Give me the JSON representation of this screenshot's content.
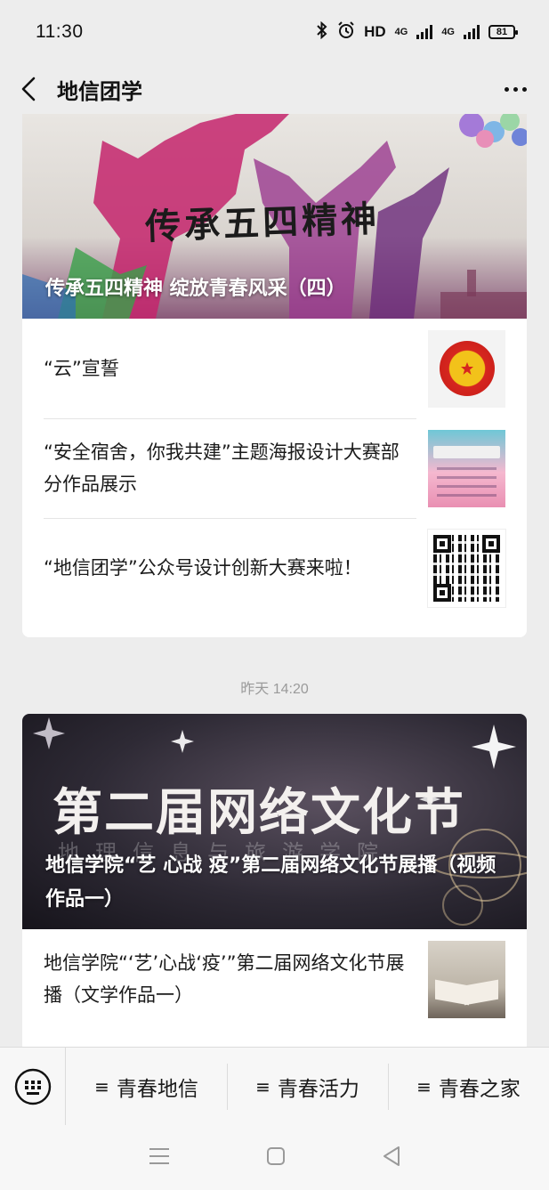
{
  "status_bar": {
    "time": "11:30",
    "hd_label": "HD",
    "net1": "4G",
    "net2": "4G",
    "battery": "81"
  },
  "nav": {
    "title": "地信团学"
  },
  "article_group_1": {
    "hero_art_text": "传承五四精神",
    "hero_caption": "传承五四精神 绽放青春风采（四）",
    "items": [
      {
        "title": "“云”宣誓",
        "thumb_icon": "league-emblem-icon"
      },
      {
        "title": "“安全宿舍，你我共建”主题海报设计大赛部分作品展示",
        "thumb_icon": "poster-thumbnail"
      },
      {
        "title": "“地信团学”公众号设计创新大赛来啦！",
        "thumb_icon": "qr-code-thumbnail"
      }
    ]
  },
  "timestamp": "昨天 14:20",
  "article_group_2": {
    "hero_art_text": "第二届网络文化节",
    "hero_art_sub": "地理信息与旅游学院",
    "hero_caption": "地信学院“艺 心战 疫”第二届网络文化节展播（视频作品一）",
    "items": [
      {
        "title": "地信学院“‘艺’心战‘疫’”第二届网络文化节展播（文学作品一）",
        "thumb_icon": "book-thumbnail"
      }
    ]
  },
  "menu": {
    "items": [
      {
        "glyph": "≡",
        "label": "青春地信"
      },
      {
        "glyph": "≡",
        "label": "青春活力"
      },
      {
        "glyph": "≡",
        "label": "青春之家"
      }
    ]
  },
  "colors": {
    "background": "#ededed",
    "card": "#ffffff",
    "timestamp": "#9a9a9a"
  }
}
